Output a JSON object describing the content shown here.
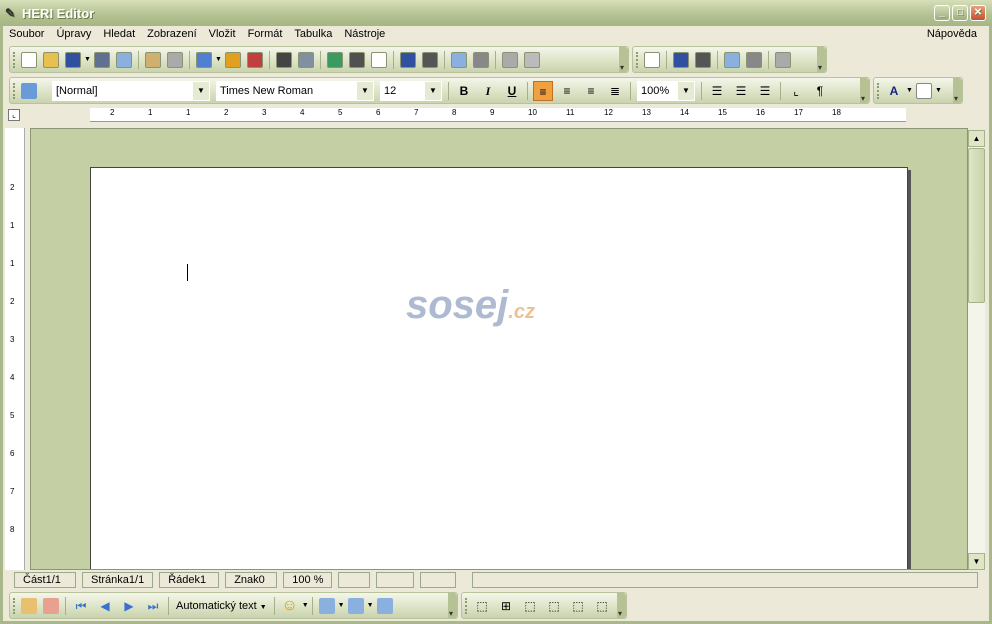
{
  "window": {
    "title": "HERI Editor"
  },
  "menu": [
    "Soubor",
    "Úpravy",
    "Hledat",
    "Zobrazení",
    "Vložit",
    "Formát",
    "Tabulka",
    "Nástroje"
  ],
  "menu_help": "Nápověda",
  "toolbar_standard": {
    "icons": [
      "new-document-icon",
      "open-folder-icon",
      "save-icon",
      "dropdown-arrow-icon",
      "save-all-icon",
      "email-icon",
      "|",
      "print-icon",
      "print-preview-icon",
      "|",
      "paste-icon",
      "dropdown-arrow-icon",
      "copy-icon",
      "cut-icon",
      "|",
      "undo-icon",
      "redo-icon",
      "|",
      "alarm-clock-icon",
      "calendar-icon",
      "date-time-icon",
      "|",
      "find-icon",
      "replace-icon",
      "|",
      "hyperlink-icon",
      "columns-icon",
      "|",
      "decrease-indent-icon",
      "increase-indent-icon"
    ]
  },
  "toolbar_table": {
    "icons": [
      "insert-table-icon",
      "|",
      "merge-cells-icon",
      "split-cells-icon",
      "|",
      "insert-row-icon",
      "insert-column-icon",
      "|",
      "table-properties-icon"
    ]
  },
  "toolbar_format": {
    "style_value": "[Normal]",
    "font_value": "Times New Roman",
    "size_value": "12",
    "bold": "B",
    "italic": "I",
    "underline": "U",
    "zoom_value": "100%",
    "pilcrow": "¶"
  },
  "ruler_labels": [
    "2",
    "1",
    "1",
    "2",
    "3",
    "4",
    "5",
    "6",
    "7",
    "8",
    "9",
    "10",
    "11",
    "12",
    "13",
    "14",
    "15",
    "16",
    "17",
    "18"
  ],
  "vruler_labels": [
    "2",
    "1",
    "1",
    "2",
    "3",
    "4",
    "5",
    "6",
    "7",
    "8"
  ],
  "watermark": {
    "text": "sosej",
    ".cz": ".cz"
  },
  "status": [
    "Část1/1",
    "Stránka1/1",
    "Řádek1",
    "Znak0",
    "100 %",
    "",
    "",
    "",
    ""
  ],
  "toolbar_bottom": {
    "autotext_label": "Automatický text"
  },
  "colors": {
    "workspace": "#c4d0a4",
    "align_active": "#f0a040"
  }
}
